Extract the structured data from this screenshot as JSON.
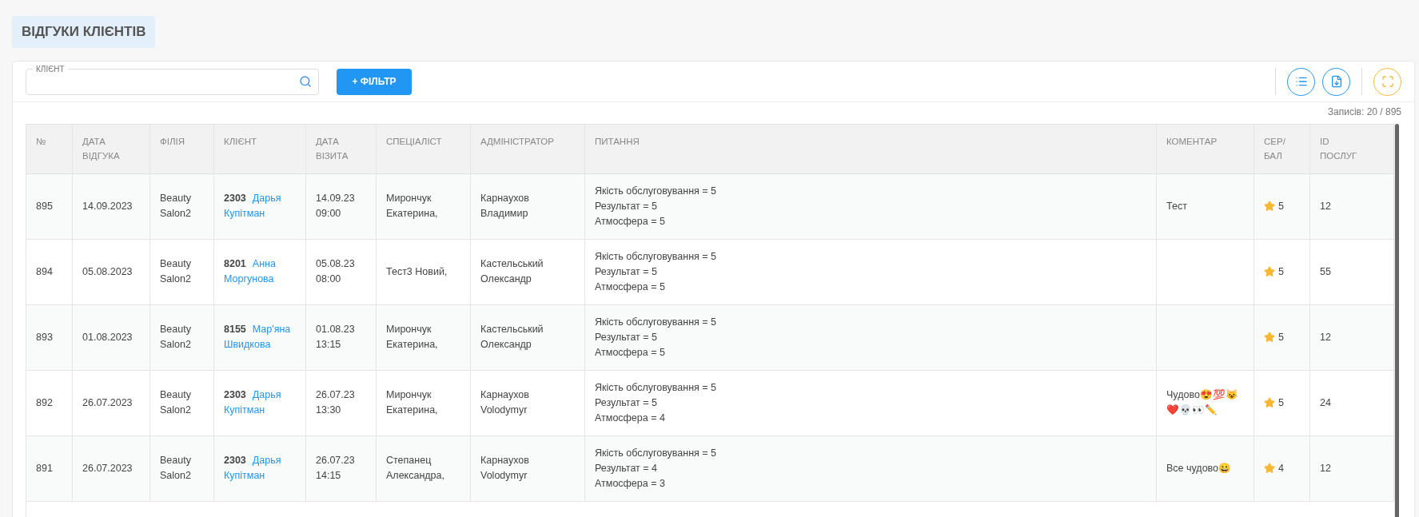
{
  "page_title": "ВІДГУКИ КЛІЄНТІВ",
  "search": {
    "label": "КЛІЄНТ"
  },
  "filter_button": "+ ФІЛЬТР",
  "records": "Записів: 20 / 895",
  "table": {
    "columns": [
      "№",
      "ДАТА ВІДГУКА",
      "ФІЛІЯ",
      "КЛІЄНТ",
      "ДАТА ВІЗИТА",
      "СПЕЦІАЛІСТ",
      "АДМІНІСТРАТОР",
      "ПИТАННЯ",
      "КОМЕНТАР",
      "СЕР/ БАЛ",
      "ID ПОСЛУГ"
    ],
    "rows": [
      {
        "number": "895",
        "review_date": "14.09.2023",
        "branch": "Beauty Salon2",
        "client_id": "2303",
        "client_name": "Дарья Купітман",
        "visit_date": "14.09.23 09:00",
        "specialist": "Мирончук Екатерина,",
        "administrator": "Карнаухов Владимир",
        "questions": [
          "Якість обслуговування = 5",
          "Результат = 5",
          "Атмосфера = 5"
        ],
        "comment": "Тест",
        "score": "5",
        "service_id": "12"
      },
      {
        "number": "894",
        "review_date": "05.08.2023",
        "branch": "Beauty Salon2",
        "client_id": "8201",
        "client_name": "Анна Моргунова",
        "visit_date": "05.08.23 08:00",
        "specialist": "Тест3 Новий,",
        "administrator": "Кастельський Олександр",
        "questions": [
          "Якість обслуговування = 5",
          "Результат = 5",
          "Атмосфера = 5"
        ],
        "score": "5",
        "service_id": "55"
      },
      {
        "number": "893",
        "review_date": "01.08.2023",
        "branch": "Beauty Salon2",
        "client_id": "8155",
        "client_name": "Мар'яна Швидкова",
        "visit_date": "01.08.23 13:15",
        "specialist": "Мирончук Екатерина,",
        "administrator": "Кастельський Олександр",
        "questions": [
          "Якість обслуговування = 5",
          "Результат = 5",
          "Атмосфера = 5"
        ],
        "score": "5",
        "service_id": "12"
      },
      {
        "number": "892",
        "review_date": "26.07.2023",
        "branch": "Beauty Salon2",
        "client_id": "2303",
        "client_name": "Дарья Купітман",
        "visit_date": "26.07.23 13:30",
        "specialist": "Мирончук Екатерина,",
        "administrator": "Карнаухов Volodymyr",
        "questions": [
          "Якість обслуговування = 5",
          "Результат = 5",
          "Атмосфера = 4"
        ],
        "comment": "Чудово😍💯😺❤️💀👀✏️",
        "score": "5",
        "service_id": "24"
      },
      {
        "number": "891",
        "review_date": "26.07.2023",
        "branch": "Beauty Salon2",
        "client_id": "2303",
        "client_name": "Дарья Купітман",
        "visit_date": "26.07.23 14:15",
        "specialist": "Степанец Александра,",
        "administrator": "Карнаухов Volodymyr",
        "questions": [
          "Якість обслуговування = 5",
          "Результат = 4",
          "Атмосфера = 3"
        ],
        "comment": "Все чудово😀",
        "score": "4",
        "service_id": "12"
      }
    ]
  }
}
